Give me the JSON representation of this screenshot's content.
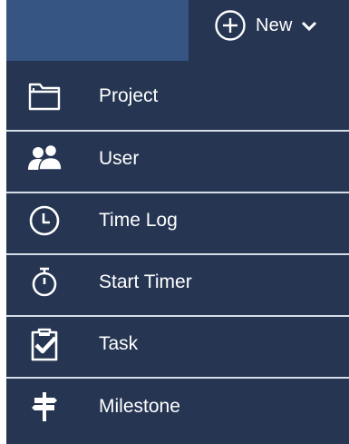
{
  "header": {
    "new_label": "New",
    "icons": {
      "new": "plus-circle-icon",
      "dropdown": "chevron-down-icon"
    }
  },
  "menu": {
    "items": [
      {
        "label": "Project",
        "icon": "folder-icon"
      },
      {
        "label": "User",
        "icon": "users-icon"
      },
      {
        "label": "Time Log",
        "icon": "clock-icon"
      },
      {
        "label": "Start Timer",
        "icon": "stopwatch-icon"
      },
      {
        "label": "Task",
        "icon": "clipboard-check-icon"
      },
      {
        "label": "Milestone",
        "icon": "signpost-icon"
      }
    ]
  },
  "colors": {
    "menu_background": "#253552",
    "search_background": "#365582",
    "divider": "#d7dde6",
    "text": "#ffffff"
  }
}
